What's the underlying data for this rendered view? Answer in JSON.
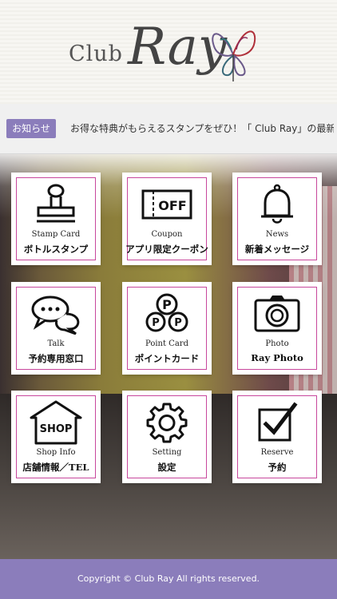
{
  "header": {
    "logo_club": "Club",
    "logo_ray": "Ray",
    "logo_icon": "butterfly-icon"
  },
  "news": {
    "tag": "お知らせ",
    "text": "お得な特典がもらえるスタンプをぜひ！「 Club Ray」の最新情報を受信"
  },
  "tiles": [
    {
      "en": "Stamp Card",
      "ja": "ボトルスタンプ",
      "icon": "stamp-icon"
    },
    {
      "en": "Coupon",
      "ja": "アプリ限定クーポン",
      "icon": "coupon-icon",
      "icon_text": "OFF"
    },
    {
      "en": "News",
      "ja": "新着メッセージ",
      "icon": "bell-icon"
    },
    {
      "en": "Talk",
      "ja": "予約専用窓口",
      "icon": "chat-icon"
    },
    {
      "en": "Point Card",
      "ja": "ポイントカード",
      "icon": "points-icon",
      "icon_text": "P"
    },
    {
      "en": "Photo",
      "ja": "Ray Photo",
      "icon": "camera-icon"
    },
    {
      "en": "Shop Info",
      "ja": "店舗情報／TEL",
      "icon": "shop-icon",
      "icon_text": "SHOP"
    },
    {
      "en": "Setting",
      "ja": "設定",
      "icon": "gear-icon"
    },
    {
      "en": "Reserve",
      "ja": "予約",
      "icon": "checkbox-icon"
    }
  ],
  "footer": {
    "copyright": "Copyright © Club Ray All rights reserved."
  },
  "colors": {
    "accent": "#8b7dbb",
    "tile_border": "#c8479c"
  }
}
